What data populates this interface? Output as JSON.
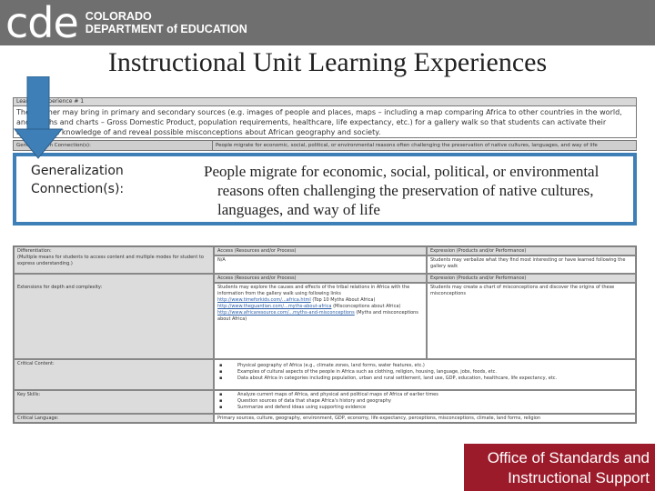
{
  "header": {
    "logo_mark": "cde",
    "org_line1": "COLORADO",
    "org_line2": "DEPARTMENT of EDUCATION",
    "title": "Instructional Unit Learning Experiences"
  },
  "doc_top": {
    "intro_label": "Learning Experience # 1",
    "intro_text": "The teacher may bring in primary and secondary sources (e.g. images of people and places, maps – including a map comparing Africa to other countries in the world, and graphs and charts – Gross Domestic Product, population requirements, healthcare, life expectancy, etc.) for a gallery walk so that students can activate their background knowledge of and reveal possible misconceptions about African geography and society.",
    "gen_label": "Generalization Connection(s):",
    "gen_text": "People migrate for economic, social, political, or environmental reasons often challenging the preservation of native cultures, languages, and way of life"
  },
  "callout": {
    "label_line1": "Generalization",
    "label_line2": "Connection(s):",
    "text_line1": "People migrate for economic, social, political, or environmental",
    "text_line2": "reasons often challenging the preservation of native cultures,",
    "text_line3": "languages, and way of life"
  },
  "table": {
    "diff_label": "Differentiation:",
    "diff_text": "(Multiple means for students to access content and multiple modes for student to express understanding.)",
    "access_head1": "Access (Resources and/or Process)",
    "access_val1": "N/A",
    "expr_head1": "Expression (Products and/or Performance)",
    "expr_val1": "Students may verbalize what they find most interesting or have learned following the gallery walk",
    "extensions_label": "Extensions for depth and complexity:",
    "access_head2": "Access (Resources and/or Process)",
    "access_val2": "Students may explore the causes and effects of the tribal relations in Africa with the information from the gallery walk using following links",
    "link1": "http://www.timeforkids.com/...africa.html",
    "link1_note": "(Top 10 Myths About Africa)",
    "link2": "http://www.theguardian.com/...myths-about-africa",
    "link2_note": "(Misconceptions about Africa)",
    "link3": "http://www.africaresource.com/...myths-and-misconceptions",
    "link3_note": "(Myths and misconceptions about Africa)",
    "expr_head2": "Expression (Products and/or Performance)",
    "expr_val2": "Students may create a chart of misconceptions and discover the origins of these misconceptions",
    "critical_content_label": "Critical Content:",
    "critical_content": [
      "Physical geography of Africa (e.g., climate zones, land forms, water features, etc.)",
      "Examples of cultural aspects of the people in Africa such as clothing, religion, housing, language, jobs, foods, etc.",
      "Data about Africa in categories including population, urban and rural settlement, land use, GDP, education, healthcare, life expectancy, etc."
    ],
    "key_skills_label": "Key Skills:",
    "key_skills": [
      "Analyze current maps of Africa, and physical and political maps of Africa of earlier times",
      "Question sources of data that shape Africa's history and geography",
      "Summarize and defend ideas using supporting evidence"
    ],
    "critical_language_label": "Critical Language:",
    "critical_language": "Primary sources, culture, geography, environment, GDP, economy, life expectancy, perceptions, misconceptions, climate, land forms, religion"
  },
  "footer": {
    "line1": "Office of Standards and",
    "line2": "Instructional Support"
  },
  "colors": {
    "banner": "#6f6f6f",
    "callout_border": "#3e7fb7",
    "arrow": "#3e7fb7",
    "footer": "#9c1b2b"
  }
}
